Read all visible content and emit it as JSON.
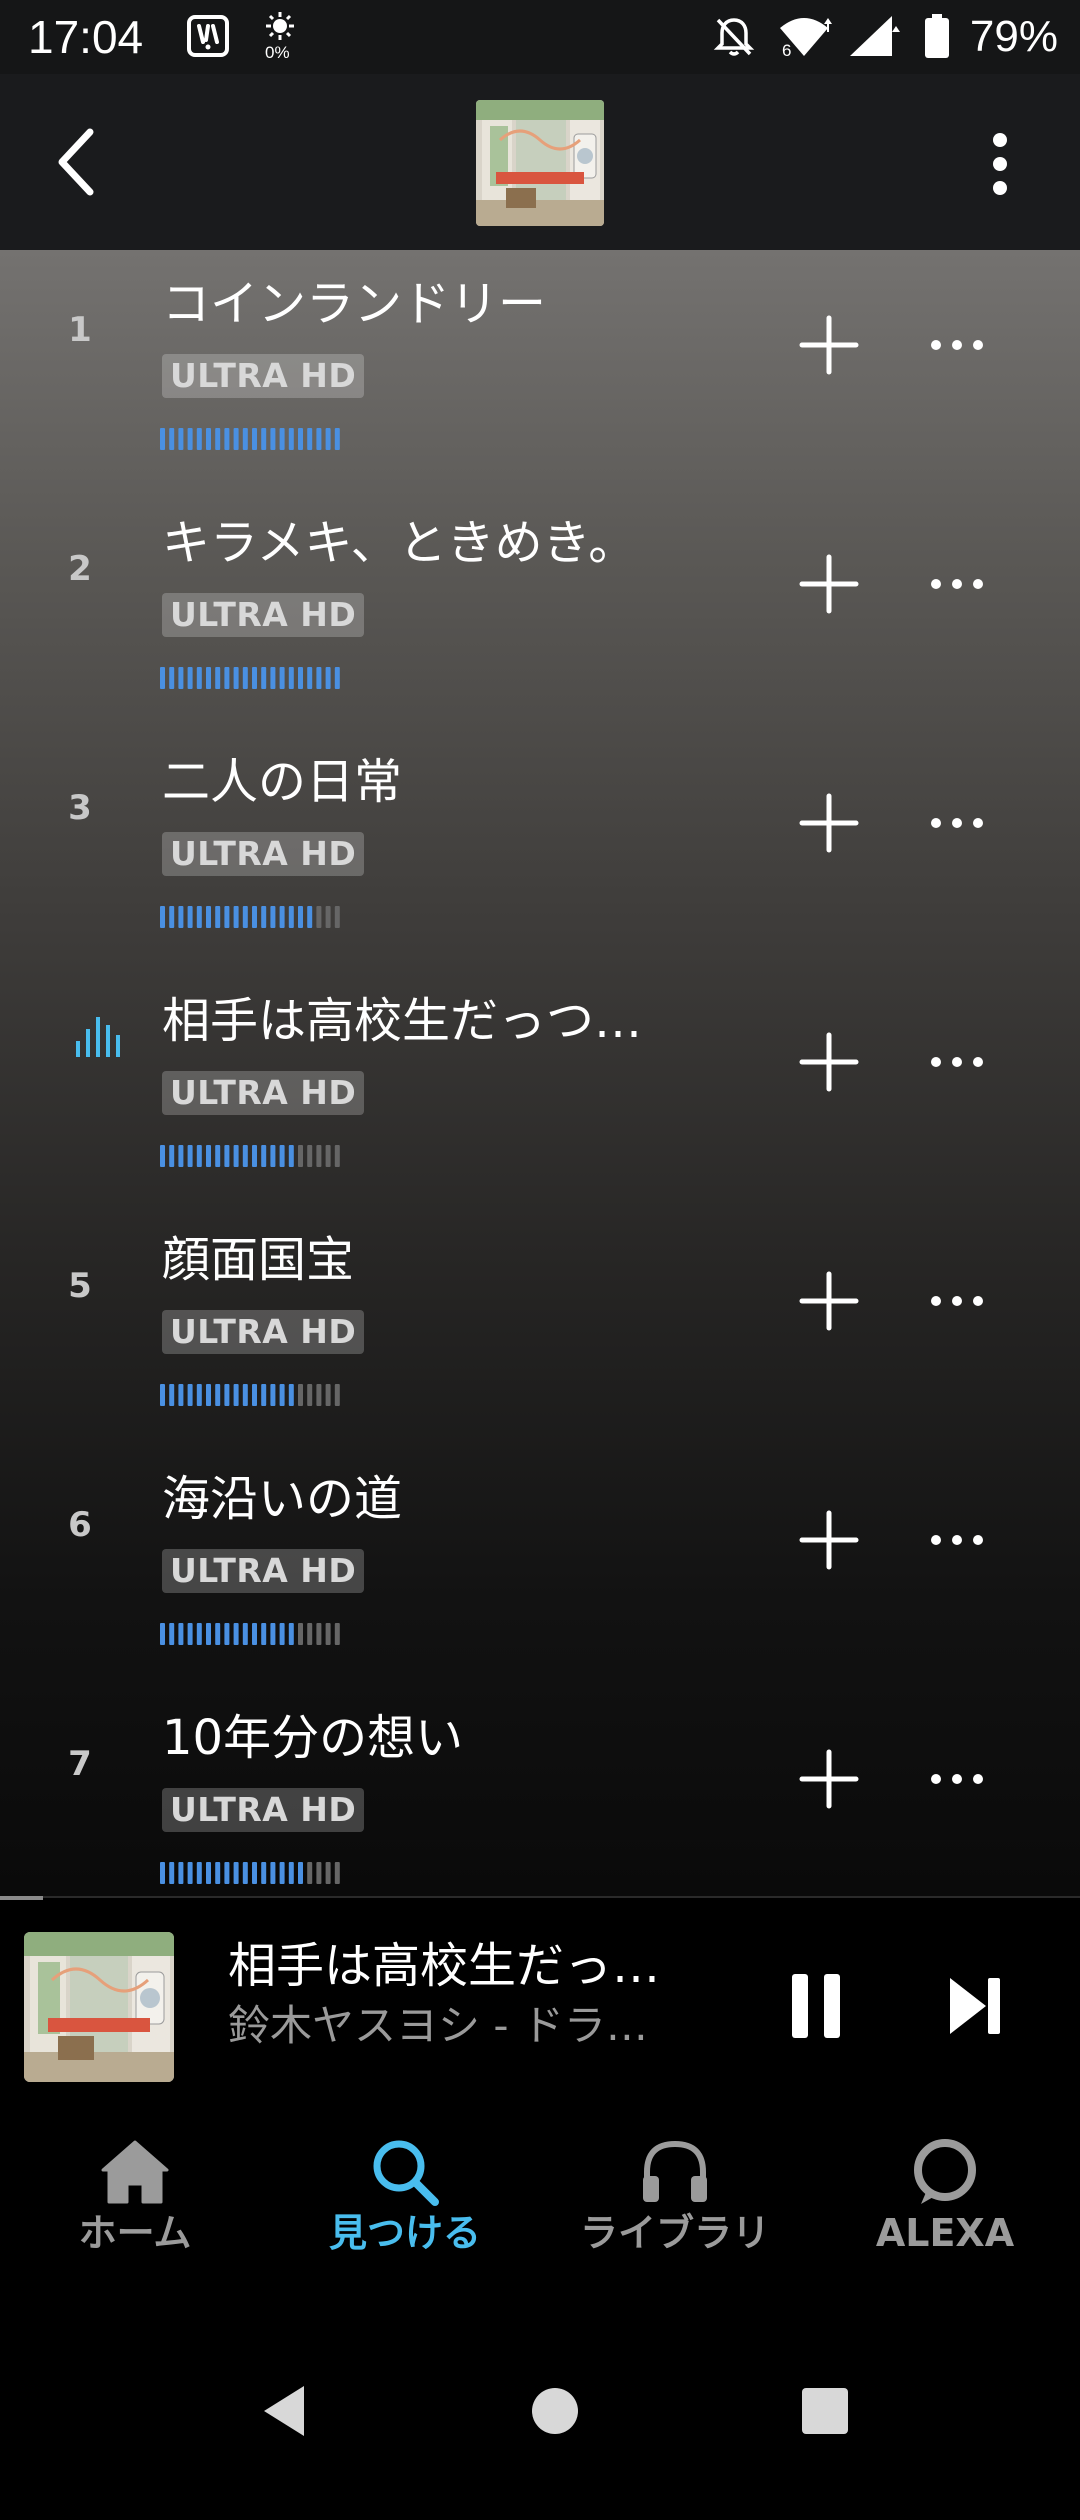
{
  "status_bar": {
    "time": "17:04",
    "data_usage": "0%",
    "network_type": "6",
    "battery": "79%",
    "icons": [
      "notification-app-icon",
      "data-saver-icon",
      "mute-icon",
      "wifi-icon",
      "signal-icon",
      "battery-icon"
    ]
  },
  "header": {
    "back_icon": "chevron-left-icon",
    "menu_icon": "more-vertical-icon"
  },
  "tracks": [
    {
      "number": "1",
      "title": "コインランドリー",
      "badge": "ULTRA HD",
      "quality_level": 1.0,
      "playing": false
    },
    {
      "number": "2",
      "title": "キラメキ、ときめき。",
      "badge": "ULTRA HD",
      "quality_level": 1.0,
      "playing": false
    },
    {
      "number": "3",
      "title": "二人の日常",
      "badge": "ULTRA HD",
      "quality_level": 0.85,
      "playing": false
    },
    {
      "number": "",
      "title": "相手は高校生だっつ…",
      "badge": "ULTRA HD",
      "quality_level": 0.75,
      "playing": true
    },
    {
      "number": "5",
      "title": "顔面国宝",
      "badge": "ULTRA HD",
      "quality_level": 0.75,
      "playing": false
    },
    {
      "number": "6",
      "title": "海沿いの道",
      "badge": "ULTRA HD",
      "quality_level": 0.75,
      "playing": false
    },
    {
      "number": "7",
      "title": "10年分の想い",
      "badge": "ULTRA HD",
      "quality_level": 0.8,
      "playing": false
    }
  ],
  "mini_player": {
    "title": "相手は高校生だっ…",
    "subtitle": "鈴木ヤスヨシ - ドラ…",
    "progress": 0.04
  },
  "bottom_nav": [
    {
      "label": "ホーム",
      "icon": "home-icon",
      "active": false
    },
    {
      "label": "見つける",
      "icon": "search-icon",
      "active": true
    },
    {
      "label": "ライブラリ",
      "icon": "headphones-icon",
      "active": false
    },
    {
      "label": "ALEXA",
      "icon": "alexa-ring-icon",
      "active": false
    }
  ],
  "colors": {
    "accent": "#49bdee",
    "quality_active": "#4a90e2",
    "quality_inactive": "#666666",
    "now_playing": "#49bdee"
  }
}
